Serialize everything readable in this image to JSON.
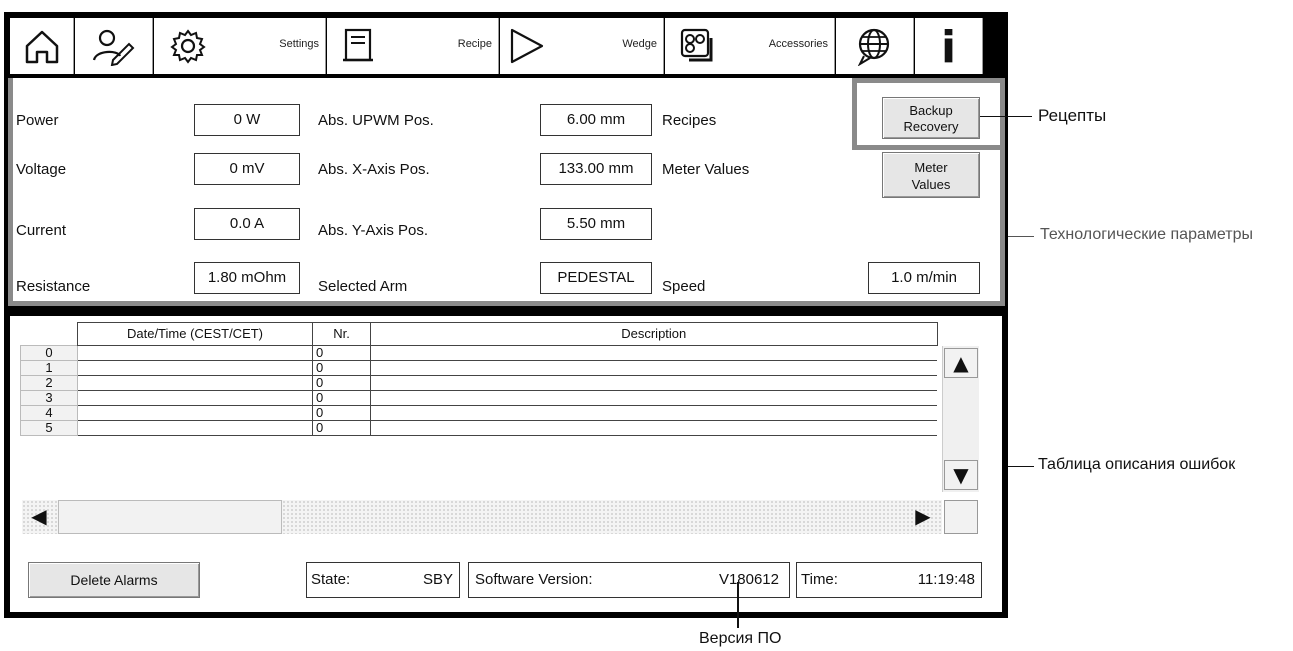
{
  "toolbar": {
    "settings_label": "Settings",
    "recipe_label": "Recipe",
    "wedge_label": "Wedge",
    "accessories_label": "Accessories",
    "info_glyph": "i"
  },
  "params": {
    "power_label": "Power",
    "power_value": "0 W",
    "voltage_label": "Voltage",
    "voltage_value": "0 mV",
    "current_label": "Current",
    "current_value": "0.0 A",
    "resistance_label": "Resistance",
    "resistance_value": "1.80 mOhm",
    "upwm_label": "Abs. UPWM Pos.",
    "upwm_value": "6.00  mm",
    "xaxis_label": "Abs. X-Axis Pos.",
    "xaxis_value": "133.00  mm",
    "yaxis_label": "Abs. Y-Axis Pos.",
    "yaxis_value": "5.50  mm",
    "arm_label": "Selected Arm",
    "arm_value": "PEDESTAL",
    "recipes_label": "Recipes",
    "meter_values_label": "Meter Values",
    "speed_label": "Speed",
    "speed_value": "1.0  m/min",
    "backup_button": [
      "Backup",
      "Recovery"
    ],
    "meter_button": [
      "Meter",
      "Values"
    ]
  },
  "alarm_table": {
    "headers": [
      "Date/Time (CEST/CET)",
      "Nr.",
      "Description"
    ],
    "rows": [
      {
        "index": "0",
        "nr": "0"
      },
      {
        "index": "1",
        "nr": "0"
      },
      {
        "index": "2",
        "nr": "0"
      },
      {
        "index": "3",
        "nr": "0"
      },
      {
        "index": "4",
        "nr": "0"
      },
      {
        "index": "5",
        "nr": "0"
      }
    ]
  },
  "status": {
    "delete_button": "Delete Alarms",
    "state_label": "State:",
    "state_value": "SBY",
    "software_label": "Software Version:",
    "software_value": "V180612",
    "time_label": "Time:",
    "time_value": "11:19:48"
  },
  "annotations": {
    "recipes": "Рецепты",
    "process_params": "Технологические параметры",
    "error_table": "Таблица описания ошибок",
    "software_version": "Версия ПО"
  },
  "colors": {
    "frame": "#000000",
    "highlight_frame": "#8a8a8a",
    "button_face": "#e6e6e6"
  }
}
